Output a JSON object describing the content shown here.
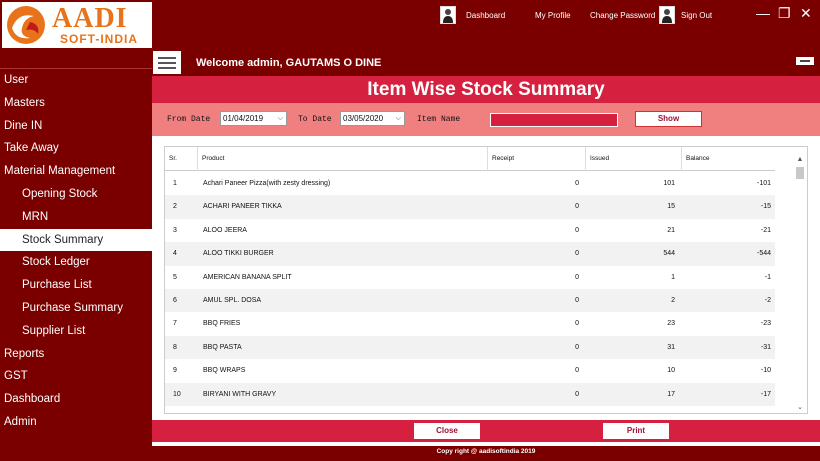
{
  "logo": {
    "main": "AADI",
    "sub": "SOFT-INDIA"
  },
  "topnav": {
    "dashboard": "Dashboard",
    "my_profile": "My Profile",
    "change_password": "Change Password",
    "sign_out": "Sign Out"
  },
  "window": {
    "minimize": "—",
    "maximize": "❐",
    "close": "✕"
  },
  "welcome": "Welcome admin, GAUTAMS O DINE",
  "sidebar": [
    {
      "label": "User",
      "sub": false
    },
    {
      "label": "Masters",
      "sub": false
    },
    {
      "label": "Dine IN",
      "sub": false
    },
    {
      "label": "Take Away",
      "sub": false
    },
    {
      "label": "Material Management",
      "sub": false
    },
    {
      "label": "Opening Stock",
      "sub": true
    },
    {
      "label": "MRN",
      "sub": true
    },
    {
      "label": "Stock Summary",
      "sub": true,
      "active": true
    },
    {
      "label": "Stock Ledger",
      "sub": true
    },
    {
      "label": "Purchase List",
      "sub": true
    },
    {
      "label": "Purchase Summary",
      "sub": true
    },
    {
      "label": "Supplier List",
      "sub": true
    },
    {
      "label": "Reports",
      "sub": false
    },
    {
      "label": "GST",
      "sub": false
    },
    {
      "label": "Dashboard",
      "sub": false
    },
    {
      "label": "Admin",
      "sub": false
    }
  ],
  "page_title": "Item Wise Stock Summary",
  "filters": {
    "from_label": "From Date",
    "from_value": "01/04/2019",
    "to_label": "To Date",
    "to_value": "03/05/2020",
    "item_label": "Item Name",
    "item_value": "",
    "show_label": "Show"
  },
  "table": {
    "headers": [
      "Sr.",
      "Product",
      "Receipt",
      "Issued",
      "Balance"
    ],
    "rows": [
      [
        "1",
        "Achari Paneer Pizza(with zesty dressing)",
        "0",
        "101",
        "-101"
      ],
      [
        "2",
        "ACHARI PANEER TIKKA",
        "0",
        "15",
        "-15"
      ],
      [
        "3",
        "ALOO JEERA",
        "0",
        "21",
        "-21"
      ],
      [
        "4",
        "ALOO TIKKI BURGER",
        "0",
        "544",
        "-544"
      ],
      [
        "5",
        "AMERICAN BANANA SPLIT",
        "0",
        "1",
        "-1"
      ],
      [
        "6",
        "AMUL SPL. DOSA",
        "0",
        "2",
        "-2"
      ],
      [
        "7",
        "BBQ FRIES",
        "0",
        "23",
        "-23"
      ],
      [
        "8",
        "BBQ PASTA",
        "0",
        "31",
        "-31"
      ],
      [
        "9",
        "BBQ WRAPS",
        "0",
        "10",
        "-10"
      ],
      [
        "10",
        "BIRYANI WITH GRAVY",
        "0",
        "17",
        "-17"
      ]
    ]
  },
  "buttons": {
    "close": "Close",
    "print": "Print"
  },
  "copyright": "Copy right @ aadisoftindia 2019",
  "colors": {
    "dark_red": "#7a0000",
    "accent": "#d5213f",
    "filter_bg": "#f08080",
    "logo_orange": "#e8731a"
  }
}
